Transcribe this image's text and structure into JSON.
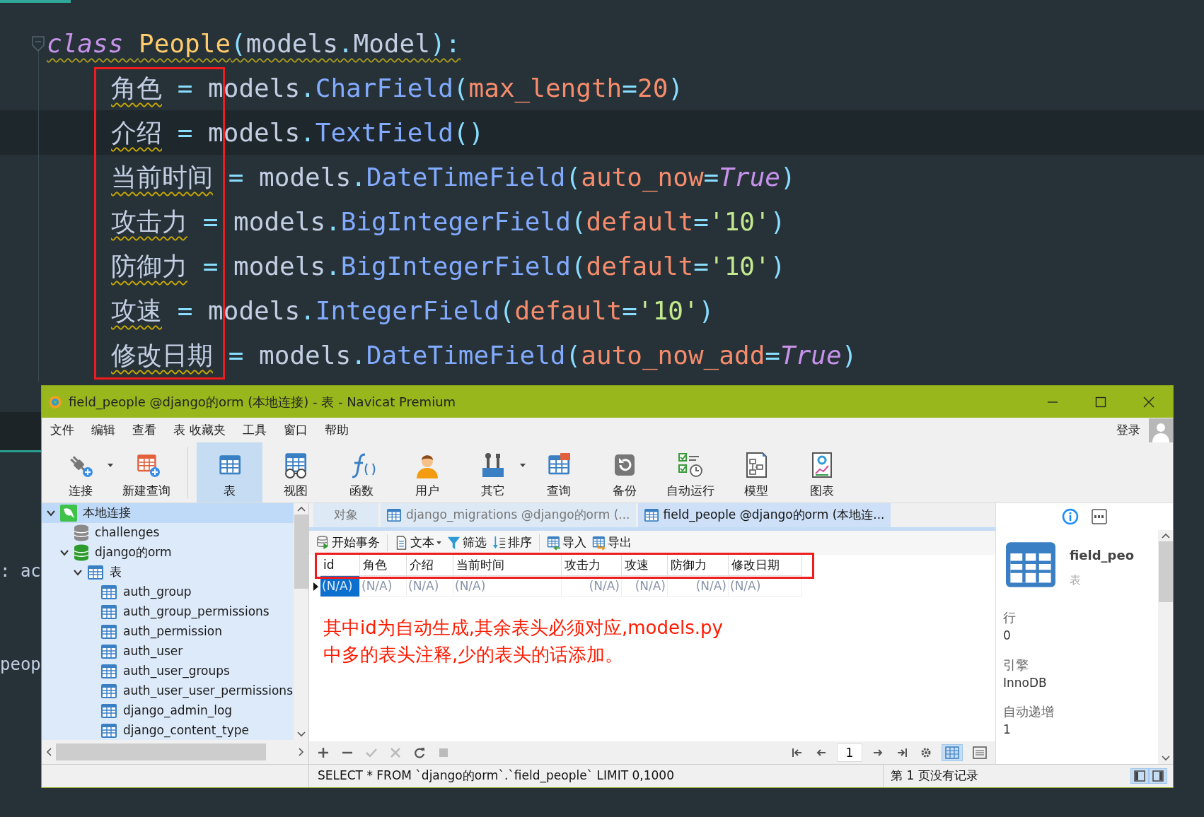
{
  "editor": {
    "lines": [
      {
        "current": false,
        "warning": true,
        "tokens": [
          {
            "text": "class ",
            "kind": "keyword"
          },
          {
            "text": "People",
            "kind": "class"
          },
          {
            "text": "(",
            "kind": "punct"
          },
          {
            "text": "models",
            "kind": "plain"
          },
          {
            "text": ".",
            "kind": "punct"
          },
          {
            "text": "Model",
            "kind": "plain"
          },
          {
            "text": "):",
            "kind": "punct"
          }
        ]
      },
      {
        "current": false,
        "warning": false,
        "tokens": [
          {
            "text": "角色",
            "kind": "name"
          },
          {
            "text": " = ",
            "kind": "punct"
          },
          {
            "text": "models",
            "kind": "plain"
          },
          {
            "text": ".",
            "kind": "punct"
          },
          {
            "text": "CharField",
            "kind": "func"
          },
          {
            "text": "(",
            "kind": "punct"
          },
          {
            "text": "max_length",
            "kind": "param"
          },
          {
            "text": "=",
            "kind": "punct"
          },
          {
            "text": "20",
            "kind": "number"
          },
          {
            "text": ")",
            "kind": "punct"
          }
        ]
      },
      {
        "current": true,
        "warning": false,
        "tokens": [
          {
            "text": "介绍",
            "kind": "name"
          },
          {
            "text": " = ",
            "kind": "punct"
          },
          {
            "text": "models",
            "kind": "plain"
          },
          {
            "text": ".",
            "kind": "punct"
          },
          {
            "text": "TextField",
            "kind": "func"
          },
          {
            "text": "()",
            "kind": "punct"
          }
        ]
      },
      {
        "current": false,
        "warning": false,
        "tokens": [
          {
            "text": "当前时间",
            "kind": "name"
          },
          {
            "text": " = ",
            "kind": "punct"
          },
          {
            "text": "models",
            "kind": "plain"
          },
          {
            "text": ".",
            "kind": "punct"
          },
          {
            "text": "DateTimeField",
            "kind": "func"
          },
          {
            "text": "(",
            "kind": "punct"
          },
          {
            "text": "auto_now",
            "kind": "param"
          },
          {
            "text": "=",
            "kind": "punct"
          },
          {
            "text": "True",
            "kind": "constant"
          },
          {
            "text": ")",
            "kind": "punct"
          }
        ]
      },
      {
        "current": false,
        "warning": false,
        "tokens": [
          {
            "text": "攻击力",
            "kind": "name"
          },
          {
            "text": " = ",
            "kind": "punct"
          },
          {
            "text": "models",
            "kind": "plain"
          },
          {
            "text": ".",
            "kind": "punct"
          },
          {
            "text": "BigIntegerField",
            "kind": "func"
          },
          {
            "text": "(",
            "kind": "punct"
          },
          {
            "text": "default",
            "kind": "param"
          },
          {
            "text": "=",
            "kind": "punct"
          },
          {
            "text": "'10'",
            "kind": "string"
          },
          {
            "text": ")",
            "kind": "punct"
          }
        ]
      },
      {
        "current": false,
        "warning": false,
        "tokens": [
          {
            "text": "防御力",
            "kind": "name"
          },
          {
            "text": " = ",
            "kind": "punct"
          },
          {
            "text": "models",
            "kind": "plain"
          },
          {
            "text": ".",
            "kind": "punct"
          },
          {
            "text": "BigIntegerField",
            "kind": "func"
          },
          {
            "text": "(",
            "kind": "punct"
          },
          {
            "text": "default",
            "kind": "param"
          },
          {
            "text": "=",
            "kind": "punct"
          },
          {
            "text": "'10'",
            "kind": "string"
          },
          {
            "text": ")",
            "kind": "punct"
          }
        ]
      },
      {
        "current": false,
        "warning": false,
        "tokens": [
          {
            "text": "攻速",
            "kind": "name"
          },
          {
            "text": " = ",
            "kind": "punct"
          },
          {
            "text": "models",
            "kind": "plain"
          },
          {
            "text": ".",
            "kind": "punct"
          },
          {
            "text": "IntegerField",
            "kind": "func"
          },
          {
            "text": "(",
            "kind": "punct"
          },
          {
            "text": "default",
            "kind": "param"
          },
          {
            "text": "=",
            "kind": "punct"
          },
          {
            "text": "'10'",
            "kind": "string"
          },
          {
            "text": ")",
            "kind": "punct"
          }
        ]
      },
      {
        "current": false,
        "warning": false,
        "tokens": [
          {
            "text": "修改日期",
            "kind": "name"
          },
          {
            "text": " = ",
            "kind": "punct"
          },
          {
            "text": "models",
            "kind": "plain"
          },
          {
            "text": ".",
            "kind": "punct"
          },
          {
            "text": "DateTimeField",
            "kind": "func"
          },
          {
            "text": "(",
            "kind": "punct"
          },
          {
            "text": "auto_now_add",
            "kind": "param"
          },
          {
            "text": "=",
            "kind": "punct"
          },
          {
            "text": "True",
            "kind": "constant"
          },
          {
            "text": ")",
            "kind": "punct"
          }
        ]
      }
    ],
    "fragments": [
      {
        "text": ": ac"
      },
      {
        "text": "peop"
      }
    ]
  },
  "window": {
    "title": "field_people @django的orm (本地连接) - 表 - Navicat Premium",
    "menu": [
      "文件",
      "编辑",
      "查看",
      "表",
      "收藏夹",
      "工具",
      "窗口",
      "帮助"
    ],
    "login": "登录",
    "toolbar": [
      [
        {
          "label": "连接",
          "selected": false,
          "dropdown": true
        },
        {
          "label": "新建查询",
          "selected": false,
          "dropdown": false
        }
      ],
      [
        {
          "label": "表",
          "selected": true,
          "dropdown": false
        },
        {
          "label": "视图",
          "selected": false,
          "dropdown": false
        },
        {
          "label": "函数",
          "selected": false,
          "dropdown": false
        },
        {
          "label": "用户",
          "selected": false,
          "dropdown": false
        },
        {
          "label": "其它",
          "selected": false,
          "dropdown": true
        },
        {
          "label": "查询",
          "selected": false,
          "dropdown": false
        },
        {
          "label": "备份",
          "selected": false,
          "dropdown": false
        },
        {
          "label": "自动运行",
          "selected": false,
          "dropdown": false
        },
        {
          "label": "模型",
          "selected": false,
          "dropdown": false
        },
        {
          "label": "图表",
          "selected": false,
          "dropdown": false
        }
      ]
    ]
  },
  "tree": [
    {
      "label": "本地连接",
      "kind": "connection",
      "expanded": true,
      "selected": true,
      "children": [
        {
          "label": "challenges",
          "kind": "database",
          "open": false,
          "selected": false
        },
        {
          "label": "django的orm",
          "kind": "database",
          "open": true,
          "expanded": true,
          "selected": false,
          "children": [
            {
              "label": "表",
              "kind": "folder",
              "expanded": true,
              "selected": false,
              "children": [
                {
                  "label": "auth_group",
                  "kind": "table",
                  "selected": false
                },
                {
                  "label": "auth_group_permissions",
                  "kind": "table",
                  "selected": false
                },
                {
                  "label": "auth_permission",
                  "kind": "table",
                  "selected": false
                },
                {
                  "label": "auth_user",
                  "kind": "table",
                  "selected": false
                },
                {
                  "label": "auth_user_groups",
                  "kind": "table",
                  "selected": false
                },
                {
                  "label": "auth_user_user_permissions",
                  "kind": "table",
                  "selected": false
                },
                {
                  "label": "django_admin_log",
                  "kind": "table",
                  "selected": false
                },
                {
                  "label": "django_content_type",
                  "kind": "table",
                  "selected": false
                }
              ]
            }
          ]
        }
      ]
    }
  ],
  "tabs": [
    {
      "label": "对象",
      "kind": "objects",
      "selected": false
    },
    {
      "label": "django_migrations @django的orm (...",
      "kind": "table",
      "selected": false
    },
    {
      "label": "field_people @django的orm (本地连...",
      "kind": "table",
      "selected": true
    }
  ],
  "grid_toolbar": [
    [
      {
        "label": "开始事务",
        "dropdown": false
      }
    ],
    [
      {
        "label": "文本",
        "dropdown": true
      },
      {
        "label": "筛选",
        "dropdown": false
      },
      {
        "label": "排序",
        "dropdown": false
      }
    ],
    [
      {
        "label": "导入",
        "dropdown": false
      },
      {
        "label": "导出",
        "dropdown": false
      }
    ]
  ],
  "grid": {
    "columns": [
      {
        "label": "id",
        "kind": "text"
      },
      {
        "label": "角色",
        "kind": "text"
      },
      {
        "label": "介绍",
        "kind": "text"
      },
      {
        "label": "当前时间",
        "kind": "text"
      },
      {
        "label": "攻击力",
        "kind": "number"
      },
      {
        "label": "攻速",
        "kind": "number"
      },
      {
        "label": "防御力",
        "kind": "number"
      },
      {
        "label": "修改日期",
        "kind": "text"
      }
    ],
    "rows": [
      {
        "current": true,
        "cells": [
          {
            "text": "(N/A)",
            "selected": true
          },
          {
            "text": "(N/A)",
            "selected": false
          },
          {
            "text": "(N/A)",
            "selected": false
          },
          {
            "text": "(N/A)",
            "selected": false
          },
          {
            "text": "(N/A)",
            "selected": false
          },
          {
            "text": "(N/A)",
            "selected": false
          },
          {
            "text": "(N/A)",
            "selected": false
          },
          {
            "text": "(N/A)",
            "selected": false
          }
        ]
      }
    ]
  },
  "note": [
    "其中id为自动生成,其余表头必须对应,models.py",
    "中多的表头注释,少的表头的话添加。"
  ],
  "pager": {
    "page": "1",
    "views": [
      {
        "selected": true
      },
      {
        "selected": false
      }
    ]
  },
  "info": {
    "name": "field_peo",
    "type": "表",
    "props": [
      {
        "label": "行",
        "value": "0"
      },
      {
        "label": "引擎",
        "value": "InnoDB"
      },
      {
        "label": "自动递增",
        "value": "1"
      }
    ]
  },
  "status_bar": {
    "sql": "SELECT * FROM `django的orm`.`field_people` LIMIT 0,1000",
    "page_info": "第 1 页没有记录"
  }
}
